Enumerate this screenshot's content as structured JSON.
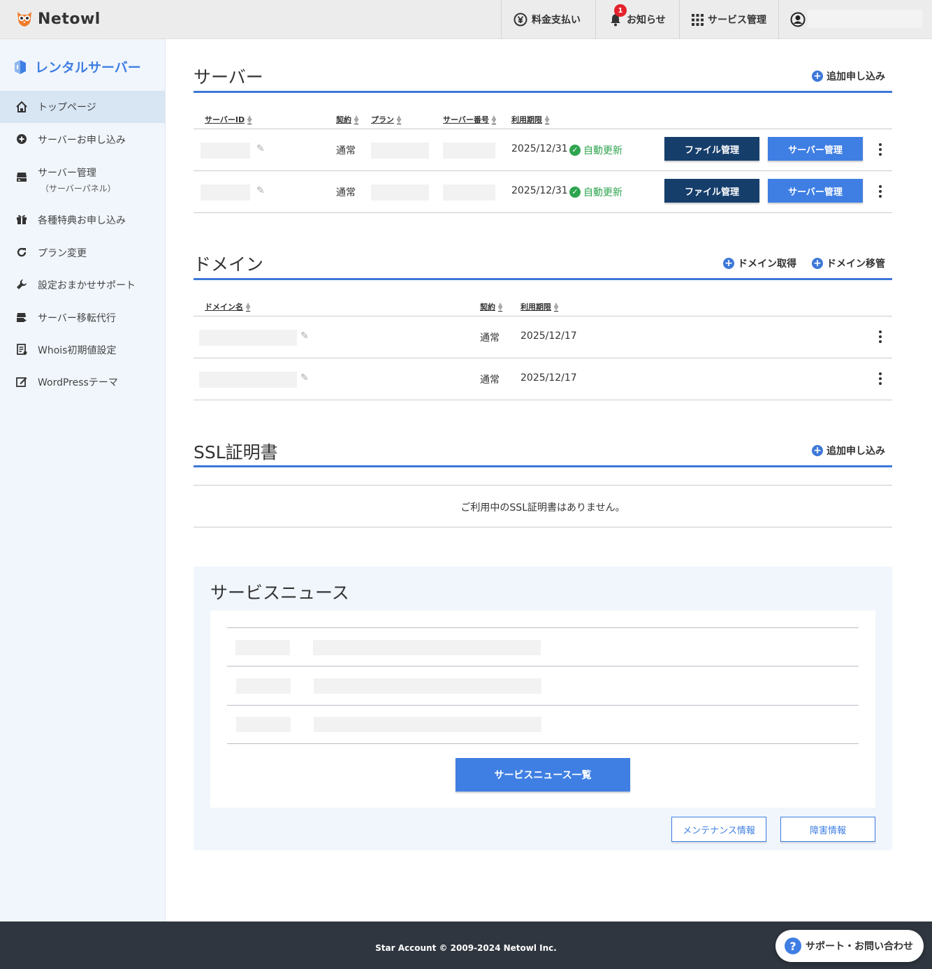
{
  "header": {
    "logo_text": "Netowl",
    "nav": [
      {
        "label": "料金支払い",
        "icon": "yen-icon"
      },
      {
        "label": "お知らせ",
        "icon": "bell-icon",
        "badge": "1"
      },
      {
        "label": "サービス管理",
        "icon": "grid-icon"
      }
    ]
  },
  "sidebar": {
    "title": "レンタルサーバー",
    "items": [
      {
        "label": "トップページ",
        "icon": "home-icon",
        "active": true
      },
      {
        "label": "サーバーお申し込み",
        "icon": "plus-circle-icon"
      },
      {
        "label": "サーバー管理",
        "sub": "（サーバーパネル）",
        "icon": "server-icon"
      },
      {
        "label": "各種特典お申し込み",
        "icon": "gift-icon"
      },
      {
        "label": "プラン変更",
        "icon": "refresh-icon"
      },
      {
        "label": "設定おまかせサポート",
        "icon": "wrench-icon"
      },
      {
        "label": "サーバー移転代行",
        "icon": "server-move-icon"
      },
      {
        "label": "Whois初期値設定",
        "icon": "document-icon"
      },
      {
        "label": "WordPressテーマ",
        "icon": "edit-box-icon"
      }
    ]
  },
  "server": {
    "title": "サーバー",
    "add_label": "追加申し込み",
    "columns": [
      "サーバーID",
      "契約",
      "プラン",
      "サーバー番号",
      "利用期限"
    ],
    "rows": [
      {
        "contract": "通常",
        "expiry": "2025/12/31",
        "status": "自動更新",
        "file_btn": "ファイル管理",
        "server_btn": "サーバー管理"
      },
      {
        "contract": "通常",
        "expiry": "2025/12/31",
        "status": "自動更新",
        "file_btn": "ファイル管理",
        "server_btn": "サーバー管理"
      }
    ]
  },
  "domain": {
    "title": "ドメイン",
    "acquire_label": "ドメイン取得",
    "transfer_label": "ドメイン移管",
    "columns": [
      "ドメイン名",
      "契約",
      "利用期限"
    ],
    "rows": [
      {
        "contract": "通常",
        "expiry": "2025/12/17"
      },
      {
        "contract": "通常",
        "expiry": "2025/12/17"
      }
    ]
  },
  "ssl": {
    "title": "SSL証明書",
    "add_label": "追加申し込み",
    "empty": "ご利用中のSSL証明書はありません。"
  },
  "news": {
    "title": "サービスニュース",
    "list_button": "サービスニュース一覧",
    "maintenance": "メンテナンス情報",
    "incident": "障害情報"
  },
  "footer": {
    "copyright": "Star Account © 2009-2024 Netowl Inc.",
    "support": "サポート・お問い合わせ"
  },
  "colors": {
    "accent": "#3f7fe4",
    "dark_button": "#163e6b",
    "success": "#2ea44f",
    "footer": "#2f363f"
  }
}
